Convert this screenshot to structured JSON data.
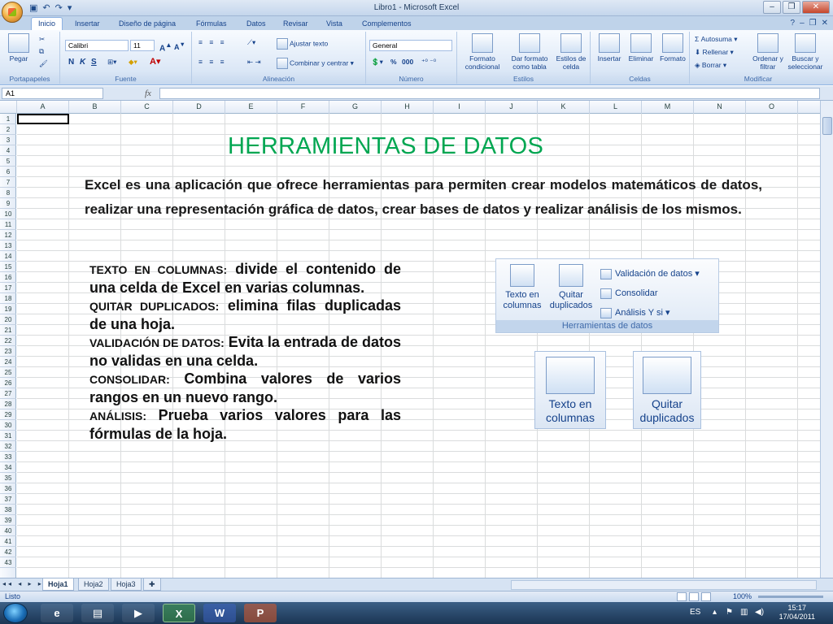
{
  "window": {
    "title": "Libro1 - Microsoft Excel"
  },
  "ribbon_tabs": [
    "Inicio",
    "Insertar",
    "Diseño de página",
    "Fórmulas",
    "Datos",
    "Revisar",
    "Vista",
    "Complementos"
  ],
  "ribbon": {
    "clipboard": {
      "paste_label": "Pegar",
      "group_label": "Portapapeles"
    },
    "font": {
      "font_name": "Calibri",
      "font_size": "11",
      "bold": "N",
      "italic": "K",
      "underline": "S",
      "group_label": "Fuente"
    },
    "alignment": {
      "wrap_label": "Ajustar texto",
      "merge_label": "Combinar y centrar",
      "group_label": "Alineación"
    },
    "number": {
      "format_value": "General",
      "percent": "%",
      "thousands": "000",
      "group_label": "Número"
    },
    "styles": {
      "conditional_label": "Formato condicional",
      "table_label": "Dar formato como tabla",
      "cell_styles_label": "Estilos de celda",
      "group_label": "Estilos"
    },
    "cells": {
      "insert_label": "Insertar",
      "delete_label": "Eliminar",
      "format_label": "Formato",
      "group_label": "Celdas"
    },
    "editing": {
      "autosum_label": "Autosuma",
      "fill_label": "Rellenar",
      "clear_label": "Borrar",
      "sort_label": "Ordenar y filtrar",
      "find_label": "Buscar y seleccionar",
      "group_label": "Modificar"
    }
  },
  "formula_bar": {
    "name_box": "A1",
    "fx": "fx",
    "value": ""
  },
  "columns": [
    "A",
    "B",
    "C",
    "D",
    "E",
    "F",
    "G",
    "H",
    "I",
    "J",
    "K",
    "L",
    "M",
    "N",
    "O"
  ],
  "rows": [
    "1",
    "2",
    "3",
    "4",
    "5",
    "6",
    "7",
    "8",
    "9",
    "10",
    "11",
    "12",
    "13",
    "14",
    "15",
    "16",
    "17",
    "18",
    "19",
    "20",
    "21",
    "22",
    "23",
    "24",
    "25",
    "26",
    "27",
    "28",
    "29",
    "30",
    "31",
    "32",
    "33",
    "34",
    "35",
    "36",
    "37",
    "38",
    "39",
    "40",
    "41",
    "42",
    "43"
  ],
  "slide": {
    "headline": "HERRAMIENTAS DE DATOS",
    "intro": "Excel es una aplicación que ofrece herramientas para permiten crear modelos matemáticos de datos, realizar una representación gráfica de datos, crear bases de datos y realizar análisis de los mismos.",
    "definitions": [
      {
        "term": "TEXTO EN COLUMNAS:",
        "text": "divide el contenido de una celda de Excel en varias columnas."
      },
      {
        "term": "QUITAR DUPLICADOS:",
        "text": "elimina filas duplicadas de una hoja."
      },
      {
        "term": "VALIDACIÓN DE DATOS:",
        "text": "Evita la entrada de datos no validas en una celda."
      },
      {
        "term": "CONSOLIDAR:",
        "text": "Combina valores de varios rangos en un nuevo rango."
      },
      {
        "term": "ANÁLISIS:",
        "text": "Prueba varios valores para las fórmulas de la hoja."
      }
    ]
  },
  "data_tools_panel": {
    "text_to_columns": "Texto en columnas",
    "remove_duplicates": "Quitar duplicados",
    "validation": "Validación de datos",
    "consolidate": "Consolidar",
    "whatif": "Análisis Y si",
    "group_label": "Herramientas de datos"
  },
  "zoomed_buttons": {
    "left": "Texto en columnas",
    "right": "Quitar duplicados"
  },
  "sheets": [
    "Hoja1",
    "Hoja2",
    "Hoja3"
  ],
  "status": {
    "mode": "Listo",
    "zoom": "100%"
  },
  "taskbar": {
    "lang": "ES",
    "time": "15:17",
    "date": "17/04/2011"
  }
}
